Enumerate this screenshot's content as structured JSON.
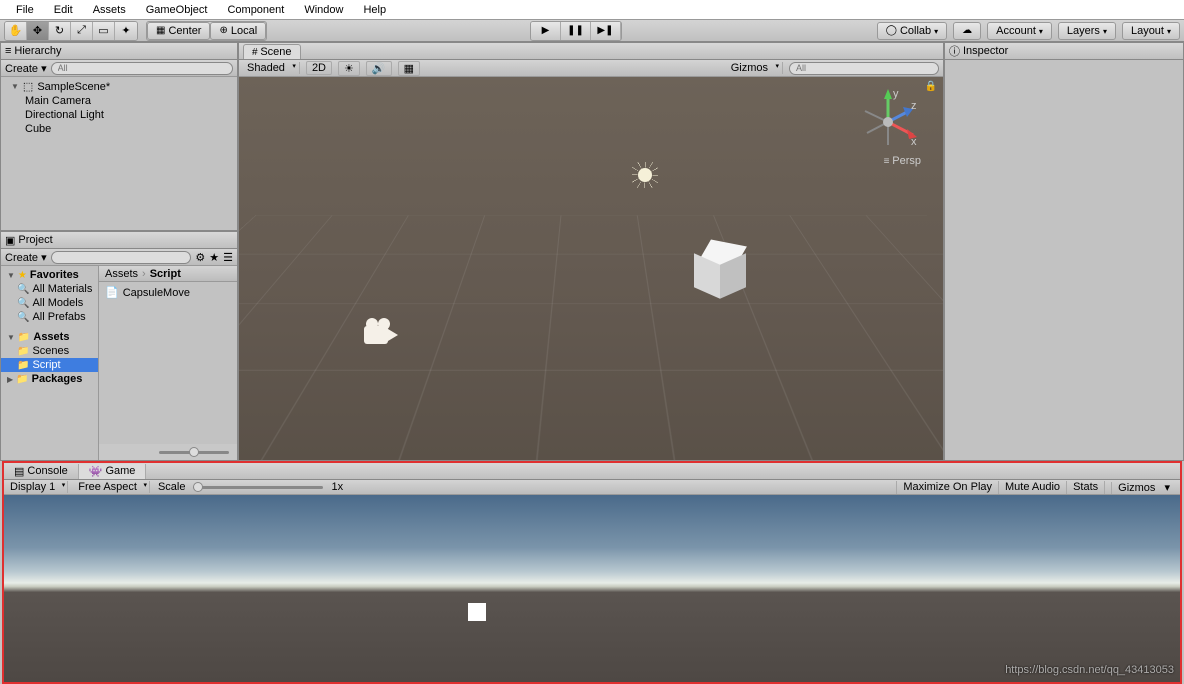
{
  "menu": [
    "File",
    "Edit",
    "Assets",
    "GameObject",
    "Component",
    "Window",
    "Help"
  ],
  "toolbar": {
    "center": "Center",
    "local": "Local",
    "collab": "Collab",
    "account": "Account",
    "layers": "Layers",
    "layout": "Layout"
  },
  "hierarchy": {
    "title": "Hierarchy",
    "create": "Create",
    "scene": "SampleScene*",
    "items": [
      "Main Camera",
      "Directional Light",
      "Cube"
    ]
  },
  "project": {
    "title": "Project",
    "create": "Create",
    "favorites": "Favorites",
    "fav_items": [
      "All Materials",
      "All Models",
      "All Prefabs"
    ],
    "assets": "Assets",
    "asset_folders": [
      "Scenes",
      "Script"
    ],
    "packages": "Packages",
    "breadcrumb": [
      "Assets",
      "Script"
    ],
    "files": [
      "CapsuleMove"
    ]
  },
  "scene": {
    "tab": "Scene",
    "shading": "Shaded",
    "mode2d": "2D",
    "gizmos": "Gizmos",
    "persp": "Persp",
    "axes": {
      "x": "x",
      "y": "y",
      "z": "z"
    }
  },
  "inspector": {
    "title": "Inspector"
  },
  "game": {
    "tabs": [
      "Console",
      "Game"
    ],
    "display": "Display 1",
    "aspect": "Free Aspect",
    "scale_label": "Scale",
    "scale_value": "1x",
    "right": [
      "Maximize On Play",
      "Mute Audio",
      "Stats",
      "Gizmos"
    ]
  },
  "watermark": "https://blog.csdn.net/qq_43413053"
}
